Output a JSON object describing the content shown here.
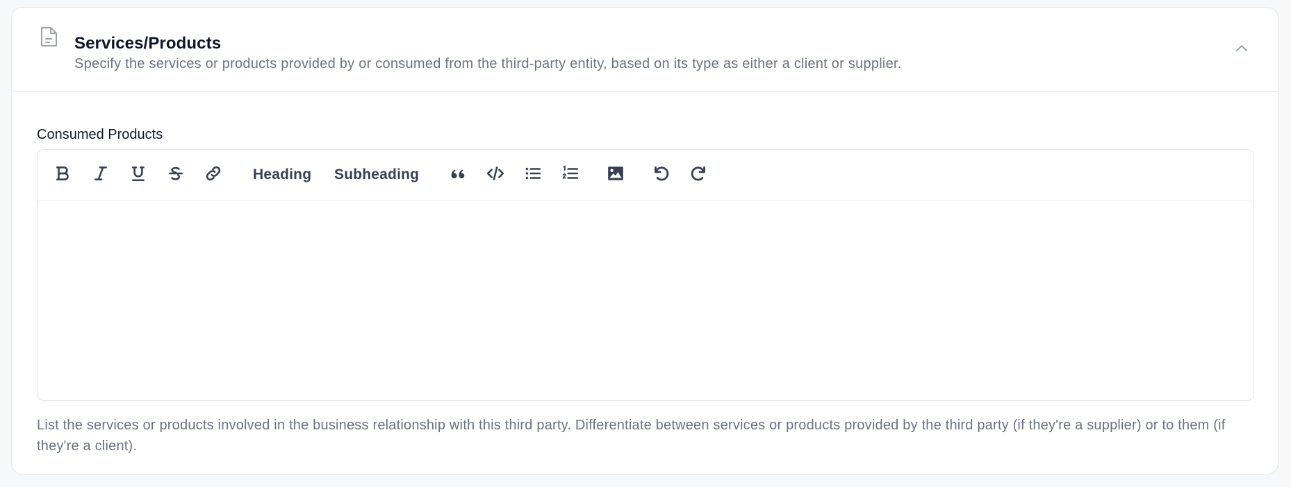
{
  "section": {
    "icon": "document-icon",
    "title": "Services/Products",
    "description": "Specify the services or products provided by or consumed from the third-party entity, based on its type as either a client or supplier.",
    "collapse_icon": "chevron-up-icon",
    "collapsed": false
  },
  "field": {
    "label": "Consumed Products",
    "value": "",
    "helper_text": "List the services or products involved in the business relationship with this third party. Differentiate between services or products provided by the third party (if they're a supplier) or to them (if they're a client)."
  },
  "toolbar": {
    "bold": {
      "icon": "bold-icon",
      "label": "Bold"
    },
    "italic": {
      "icon": "italic-icon",
      "label": "Italic"
    },
    "underline": {
      "icon": "underline-icon",
      "label": "Underline"
    },
    "strikethrough": {
      "icon": "strikethrough-icon",
      "label": "Strikethrough"
    },
    "link": {
      "icon": "link-icon",
      "label": "Link"
    },
    "heading_label": "Heading",
    "subheading_label": "Subheading",
    "quote": {
      "icon": "quote-icon",
      "label": "Quote"
    },
    "code": {
      "icon": "code-icon",
      "label": "Code"
    },
    "bullet_list": {
      "icon": "bullet-list-icon",
      "label": "Bullet list"
    },
    "ordered_list": {
      "icon": "ordered-list-icon",
      "label": "Ordered list"
    },
    "image": {
      "icon": "image-icon",
      "label": "Image"
    },
    "undo": {
      "icon": "undo-icon",
      "label": "Undo"
    },
    "redo": {
      "icon": "redo-icon",
      "label": "Redo"
    }
  },
  "colors": {
    "background": "#f7f8fa",
    "card": "#ffffff",
    "border": "#e5e7eb",
    "title_text": "#0f172a",
    "muted_text": "#6b7280",
    "toolbar_icon": "#374151"
  }
}
